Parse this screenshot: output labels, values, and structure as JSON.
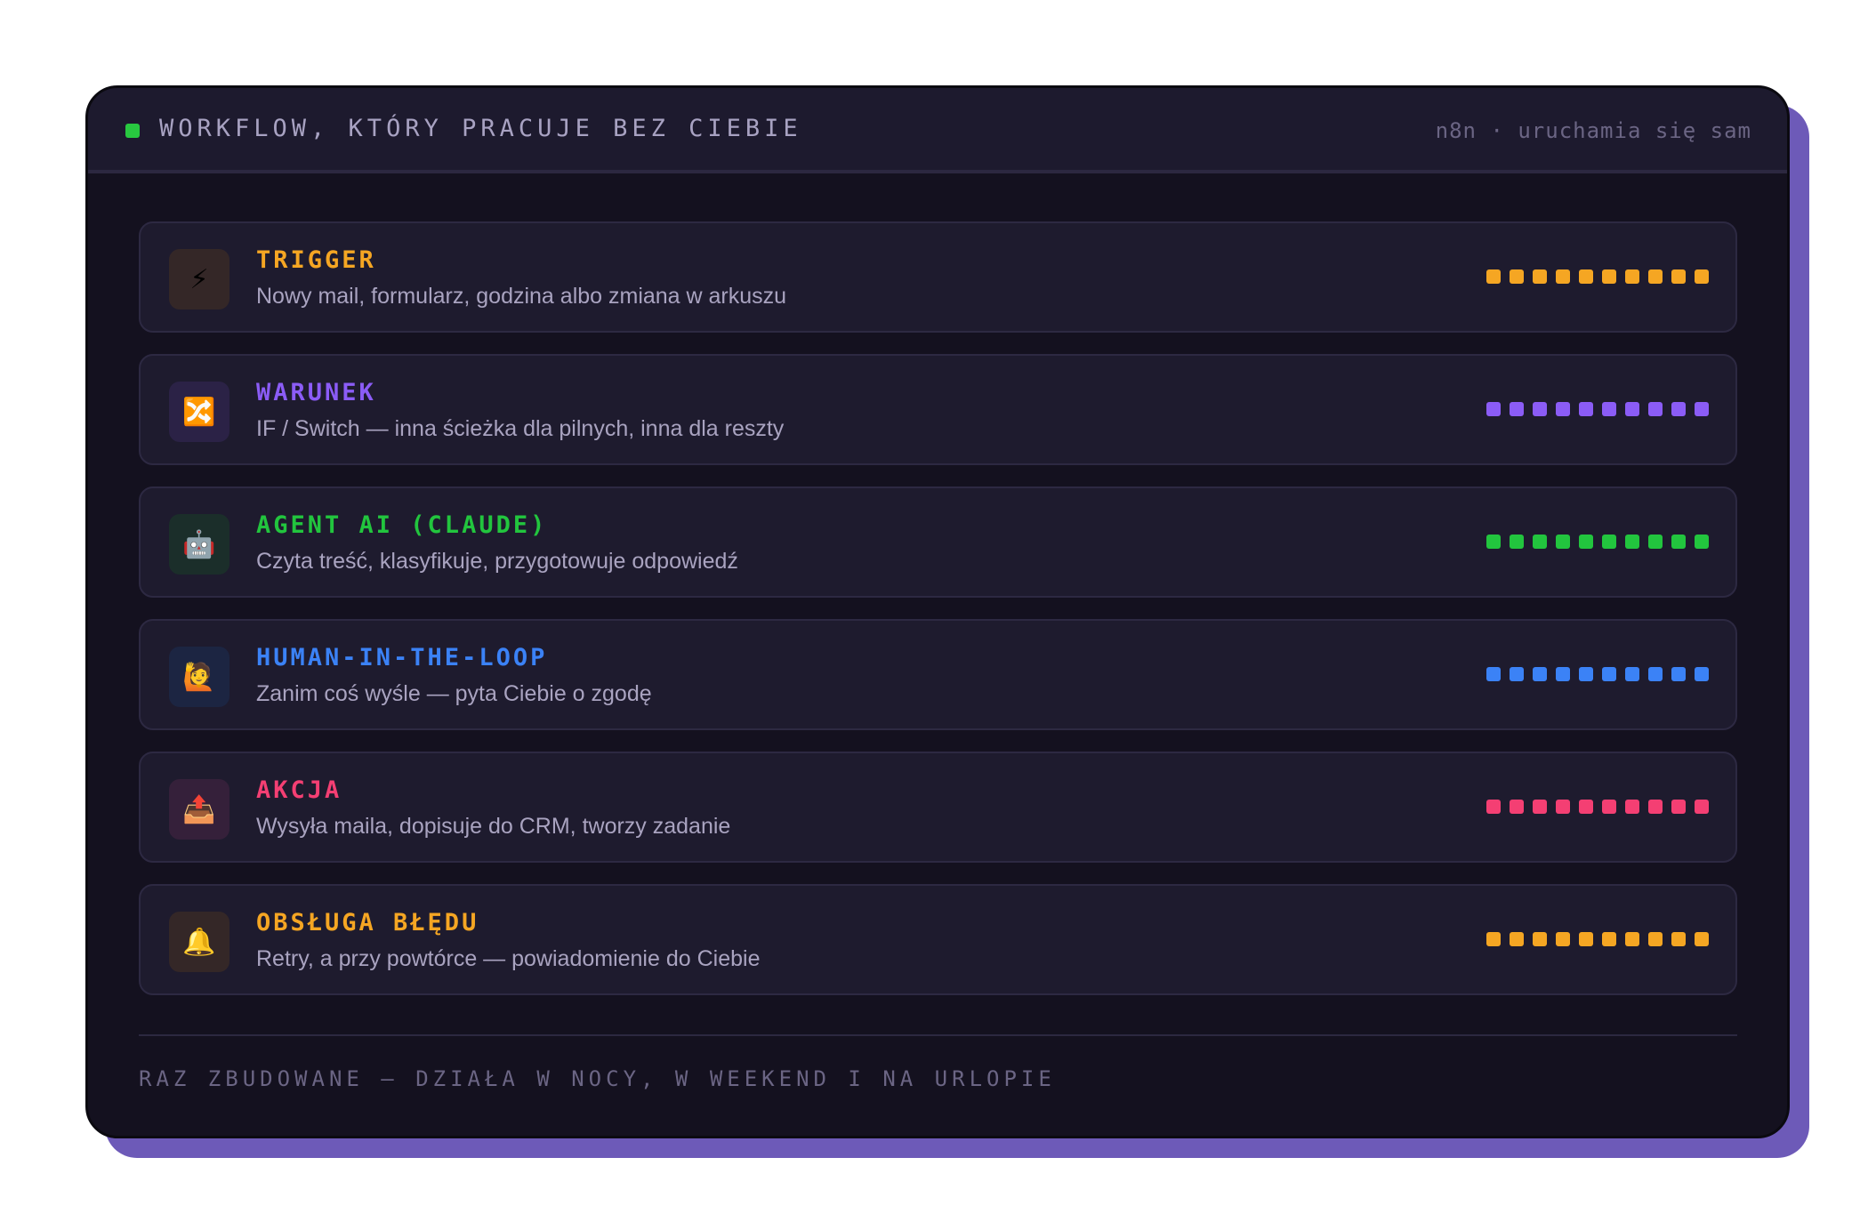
{
  "header": {
    "title": "WORKFLOW, KTÓRY PRACUJE BEZ CIEBIE",
    "meta": "n8n · uruchamia się sam",
    "status_color": "#28c840"
  },
  "steps": [
    {
      "icon": "⚡",
      "icon_name": "lightning-icon",
      "title": "TRIGGER",
      "desc": "Nowy mail, formularz, godzina albo zmiana w arkuszu",
      "color": "#f5a623"
    },
    {
      "icon": "🔀",
      "icon_name": "shuffle-icon",
      "title": "WARUNEK",
      "desc": "IF / Switch — inna ścieżka dla pilnych, inna dla reszty",
      "color": "#8b5cf6"
    },
    {
      "icon": "🤖",
      "icon_name": "robot-icon",
      "title": "AGENT AI (CLAUDE)",
      "desc": "Czyta treść, klasyfikuje, przygotowuje odpowiedź",
      "color": "#22c53e"
    },
    {
      "icon": "🙋",
      "icon_name": "person-raising-hand-icon",
      "title": "HUMAN-IN-THE-LOOP",
      "desc": "Zanim coś wyśle — pyta Ciebie o zgodę",
      "color": "#3b82f6"
    },
    {
      "icon": "📤",
      "icon_name": "outbox-tray-icon",
      "title": "AKCJA",
      "desc": "Wysyła maila, dopisuje do CRM, tworzy zadanie",
      "color": "#f43f73"
    },
    {
      "icon": "🔔",
      "icon_name": "bell-icon",
      "title": "OBSŁUGA BŁĘDU",
      "desc": "Retry, a przy powtórce — powiadomienie do Ciebie",
      "color": "#f5a623"
    }
  ],
  "footer": {
    "text": "RAZ ZBUDOWANE — DZIAŁA W NOCY, W WEEKEND I NA URLOPIE"
  }
}
